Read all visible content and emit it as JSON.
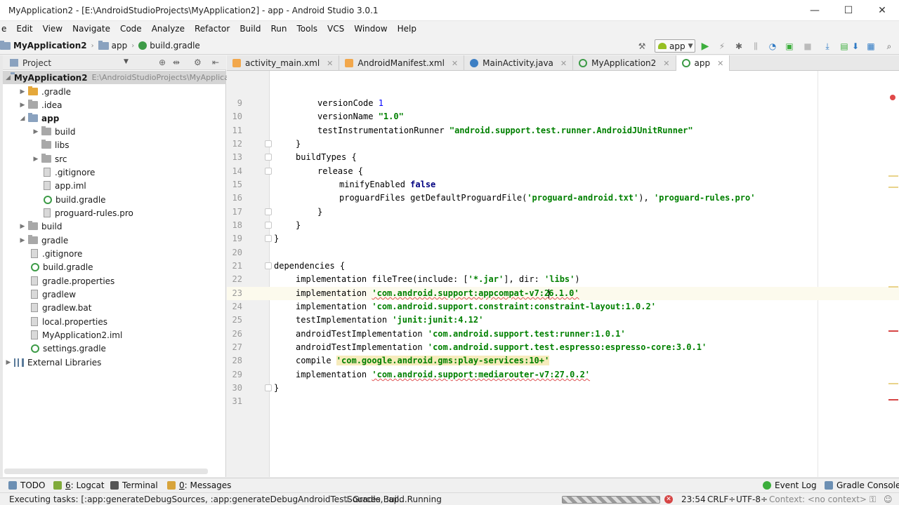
{
  "window": {
    "title": "MyApplication2 - [E:\\AndroidStudioProjects\\MyApplication2] - app - Android Studio 3.0.1",
    "minimize": "—",
    "maximize": "☐",
    "close": "✕"
  },
  "menu": [
    "e",
    "Edit",
    "View",
    "Navigate",
    "Code",
    "Analyze",
    "Refactor",
    "Build",
    "Run",
    "Tools",
    "VCS",
    "Window",
    "Help"
  ],
  "nav": {
    "project": "MyApplication2",
    "module": "app",
    "file": "build.gradle",
    "run_config": "app"
  },
  "project_panel": {
    "title": "Project",
    "tree": [
      {
        "label": "MyApplication2",
        "path": "E:\\AndroidStudioProjects\\MyApplica",
        "bold": true
      },
      {
        "label": ".gradle"
      },
      {
        "label": ".idea"
      },
      {
        "label": "app",
        "bold": true
      },
      {
        "label": "build"
      },
      {
        "label": "libs"
      },
      {
        "label": "src"
      },
      {
        "label": ".gitignore"
      },
      {
        "label": "app.iml"
      },
      {
        "label": "build.gradle"
      },
      {
        "label": "proguard-rules.pro"
      },
      {
        "label": "build"
      },
      {
        "label": "gradle"
      },
      {
        "label": ".gitignore"
      },
      {
        "label": "build.gradle"
      },
      {
        "label": "gradle.properties"
      },
      {
        "label": "gradlew"
      },
      {
        "label": "gradlew.bat"
      },
      {
        "label": "local.properties"
      },
      {
        "label": "MyApplication2.iml"
      },
      {
        "label": "settings.gradle"
      },
      {
        "label": "External Libraries"
      }
    ]
  },
  "tabs": [
    {
      "label": "activity_main.xml"
    },
    {
      "label": "AndroidManifest.xml"
    },
    {
      "label": "MainActivity.java"
    },
    {
      "label": "MyApplication2"
    },
    {
      "label": "app"
    }
  ],
  "editor": {
    "line_numbers": [
      "9",
      "10",
      "11",
      "12",
      "13",
      "14",
      "15",
      "16",
      "17",
      "18",
      "19",
      "20",
      "21",
      "22",
      "23",
      "24",
      "25",
      "26",
      "27",
      "28",
      "29",
      "30",
      "31"
    ],
    "code": {
      "l9_a": "versionCode ",
      "l9_b": "1",
      "l10_a": "versionName ",
      "l10_b": "\"1.0\"",
      "l11_a": "testInstrumentationRunner ",
      "l11_b": "\"android.support.test.runner.AndroidJUnitRunner\"",
      "l12": "}",
      "l13": "buildTypes {",
      "l14": "release {",
      "l15_a": "minifyEnabled ",
      "l15_b": "false",
      "l16_a": "proguardFiles getDefaultProguardFile(",
      "l16_b": "'proguard-android.txt'",
      "l16_c": "), ",
      "l16_d": "'proguard-rules.pro'",
      "l17": "}",
      "l18": "}",
      "l19": "}",
      "l21": "dependencies {",
      "l22_a": "implementation fileTree(include: [",
      "l22_b": "'*.jar'",
      "l22_c": "], dir: ",
      "l22_d": "'libs'",
      "l22_e": ")",
      "l23_a": "implementation ",
      "l23_b": "'com.android.support:appcompat-v7:2",
      "l23_c": "6.1.0'",
      "l24_a": "implementation ",
      "l24_b": "'com.android.support.constraint:constraint-layout:1.0.2'",
      "l25_a": "testImplementation ",
      "l25_b": "'junit:junit:4.12'",
      "l26_a": "androidTestImplementation ",
      "l26_b": "'com.android.support.test:runner:1.0.1'",
      "l27_a": "androidTestImplementation ",
      "l27_b": "'com.android.support.test.espresso:espresso-core:3.0.1'",
      "l28_a": "compile ",
      "l28_b": "'com.google.android.gms:play-services:10+'",
      "l29_a": "implementation ",
      "l29_b": "'com.android.support:mediarouter-v7:27.0.2'",
      "l30": "}"
    }
  },
  "bottom_tools": {
    "todo": "TODO",
    "logcat_num": "6",
    "logcat": ": Logcat",
    "terminal": "Terminal",
    "messages_num": "0",
    "messages": ": Messages",
    "event_log": "Event Log",
    "gradle_console": "Gradle Console"
  },
  "status": {
    "message": "Executing tasks: [:app:generateDebugSources, :app:generateDebugAndroidTestSources, :ap...",
    "build": "Gradle Build Running",
    "position": "23:54",
    "line_sep": "CRLF÷",
    "encoding": "UTF-8÷",
    "context": "Context: <no context>"
  }
}
